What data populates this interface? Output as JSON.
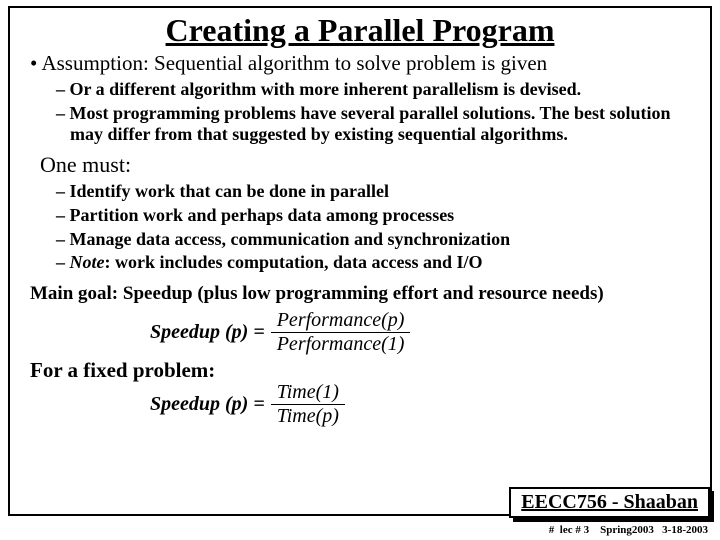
{
  "title": "Creating a Parallel Program",
  "bullet1": "• Assumption:  Sequential algorithm to solve problem is given",
  "sub1a": "– Or a different algorithm with more inherent parallelism is devised.",
  "sub1b": "– Most programming problems have several parallel solutions. The best solution may differ from that suggested by existing sequential algorithms.",
  "onemust": "One must:",
  "sub2a": "– Identify work that can be done in parallel",
  "sub2b": "– Partition work and perhaps data among processes",
  "sub2c": "– Manage data access, communication and synchronization",
  "sub2d_prefix": "– ",
  "sub2d_note": "Note",
  "sub2d_rest": ": work includes computation, data access and I/O",
  "maingoal": "Main goal:   Speedup (plus low programming effort and resource needs)",
  "formula1": {
    "lhs": "Speedup (p) = ",
    "num": "Performance(p)",
    "den": "Performance(1)"
  },
  "fixed": "For a fixed problem:",
  "formula2": {
    "lhs": "Speedup (p) = ",
    "num": "Time(1)",
    "den": "Time(p)"
  },
  "course": "EECC756 - Shaaban",
  "footer": "#  lec # 3    Spring2003   3-18-2003"
}
